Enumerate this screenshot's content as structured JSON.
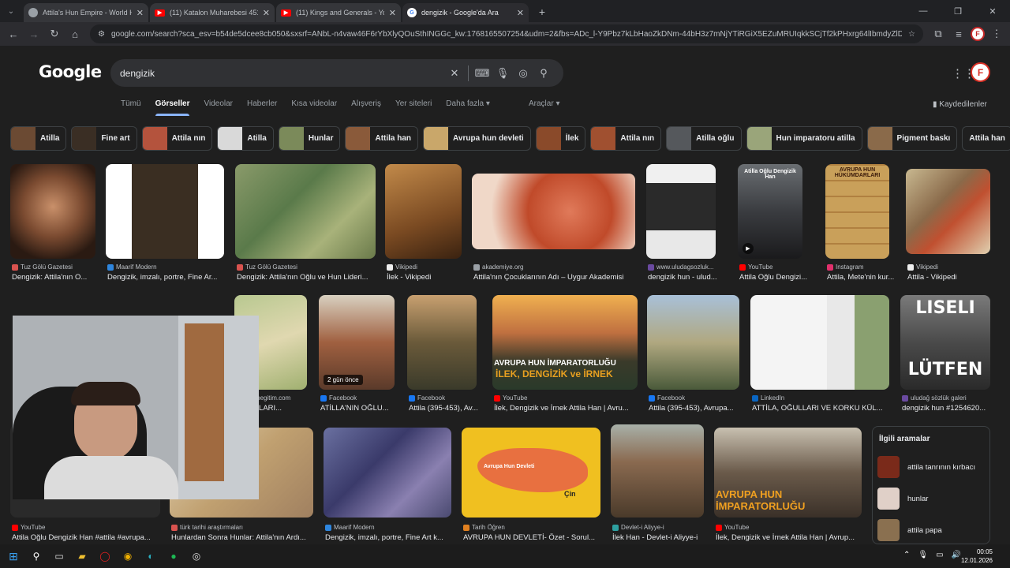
{
  "tabs": [
    {
      "title": "Attila's Hun Empire - World Hi",
      "favicon": "world-history-icon",
      "active": false
    },
    {
      "title": "(11) Katalon Muharebesi 451 -",
      "favicon": "youtube-icon",
      "active": false
    },
    {
      "title": "(11) Kings and Generals - YouT",
      "favicon": "youtube-icon",
      "active": false
    },
    {
      "title": "dengizik - Google'da Ara",
      "favicon": "google-icon",
      "active": true
    }
  ],
  "address": {
    "url": "google.com/search?sca_esv=b54de5dcee8cb050&sxsrf=ANbL-n4vaw46F6rYbXlyQOuSthINGGc_kw:1768165507254&udm=2&fbs=ADc_l-Y9Pbz7kLbHaoZkDNm-44bH3z7mNjYTiRGiX5EZuMRUIqkkSCjTf2kPHxrg64lIbmdyZlDWCg6rbvB1MgosL8..."
  },
  "google": {
    "logo": "Google",
    "query": "dengizik"
  },
  "nav": {
    "tabs": [
      "Tümü",
      "Görseller",
      "Videolar",
      "Haberler",
      "Kısa videolar",
      "Alışveriş",
      "Yer siteleri",
      "Daha fazla ▾"
    ],
    "active": "Görseller",
    "tools": "Araçlar ▾",
    "saved": "Kaydedilenler"
  },
  "chips": [
    {
      "label": "Atilla",
      "thumb": "#6b4a33"
    },
    {
      "label": "Fine art",
      "thumb": "#3a2e24"
    },
    {
      "label": "Attila nın",
      "thumb": "#b4533d"
    },
    {
      "label": "Atilla",
      "thumb": "#d9d9d9"
    },
    {
      "label": "Hunlar",
      "thumb": "#7b8a5a"
    },
    {
      "label": "Attila han",
      "thumb": "#8a5a3a"
    },
    {
      "label": "Avrupa hun devleti",
      "thumb": "#c9a76a"
    },
    {
      "label": "İlek",
      "thumb": "#8a4a2a"
    },
    {
      "label": "Attila nın",
      "thumb": "#a05030"
    },
    {
      "label": "Atilla oğlu",
      "thumb": "#55585c"
    },
    {
      "label": "Hun imparatoru atilla",
      "thumb": "#9aa57a"
    },
    {
      "label": "Pigment baskı",
      "thumb": "#8a6a4a"
    },
    {
      "label": "Attila han",
      "thumb": ""
    }
  ],
  "results": [
    {
      "source": "Tuz Gölü Gazetesi",
      "caption": "Dengizik: Attila'nın O..."
    },
    {
      "source": "Maarif Modern",
      "caption": "Dengizik, imzalı, portre, Fine Ar..."
    },
    {
      "source": "Tuz Gölü Gazetesi",
      "caption": "Dengizik: Attila'nın Oğlu ve Hun Lideri..."
    },
    {
      "source": "Vikipedi",
      "caption": "İlek - Vikipedi"
    },
    {
      "source": "akademiye.org",
      "caption": "Attila'nın Çocuklarının Adı – Uygur Akademisi"
    },
    {
      "source": "www.uludagsozluk...",
      "caption": "dengizik hun - ulud..."
    },
    {
      "source": "YouTube",
      "caption": "Attila Oğlu Dengizi...",
      "overlay": "Atilla Oğlu Dengizik Han"
    },
    {
      "source": "Instagram",
      "caption": "Attila, Mete'nin kur...",
      "overlay": "AVRUPA HUN HÜKÜMDARLARI"
    },
    {
      "source": "Vikipedi",
      "caption": "Attila - Vikipedi"
    },
    {
      "source": "aktanegitim.com",
      "caption": "A HUNLARI..."
    },
    {
      "source": "Facebook",
      "caption": "ATİLLA'NIN OĞLU...",
      "badge": "2 gün önce"
    },
    {
      "source": "Facebook",
      "caption": "Attila (395-453), Av..."
    },
    {
      "source": "YouTube",
      "caption": "İlek, Dengizik ve İrnek Attila Han | Avru...",
      "overlay": "AVRUPA HUN İMPARATORLUĞU",
      "overlay2": "İLEK, DENGİZİK ve İRNEK"
    },
    {
      "source": "Facebook",
      "caption": "Attila (395-453), Avrupa..."
    },
    {
      "source": "LinkedIn",
      "caption": "ATTİLA, OĞULLARI VE KORKU KÜL..."
    },
    {
      "source": "uludağ sözlük galeri",
      "caption": "dengizik hun #1254620...",
      "overlay": "LISELI",
      "overlay2": "LÜTFEN"
    },
    {
      "source": "YouTube",
      "caption": "Attila Oğlu Dengizik Han #attila #avrupa..."
    },
    {
      "source": "türk tarihi araştırmaları",
      "caption": "Hunlardan Sonra Hunlar: Attila'nın Ardı..."
    },
    {
      "source": "Maarif Modern",
      "caption": "Dengizik, imzalı, portre, Fine Art k..."
    },
    {
      "source": "Tarih Öğren",
      "caption": "AVRUPA HUN DEVLETİ- Özet - Sorul...",
      "overlay": "Avrupa Hun Devleti",
      "overlay2": "Çin"
    },
    {
      "source": "Devlet-i Aliyye-i",
      "caption": "İlek Han - Devlet-i Aliyye-i"
    },
    {
      "source": "YouTube",
      "caption": "İlek, Dengizik ve İrnek Attila Han | Avrup...",
      "overlay": "AVRUPA HUN",
      "overlay2": "İMPARATORLUĞU"
    }
  ],
  "related": {
    "title": "İlgili aramalar",
    "items": [
      "attila tanrının kırbacı",
      "hunlar",
      "attila papa"
    ]
  },
  "taskbar": {
    "time": "00:05",
    "date": "12.01.2026"
  }
}
